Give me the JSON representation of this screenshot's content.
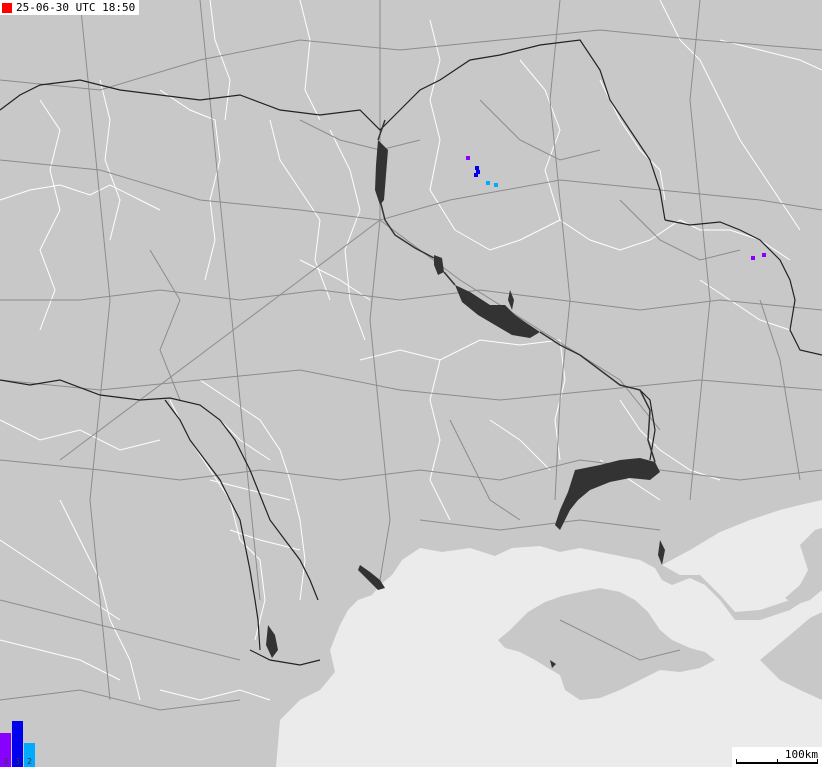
{
  "timestamp": {
    "text": "25-06-30 UTC 18:50",
    "indicator_color": "#ff0000"
  },
  "scale": {
    "label": "100km"
  },
  "legend": {
    "bars": [
      {
        "label": "3",
        "color": "#8800ff"
      },
      {
        "label": "3",
        "color": "#0000ee"
      },
      {
        "label": "2",
        "color": "#00aaff"
      }
    ]
  },
  "strikes": [
    {
      "color": "#8800ff"
    },
    {
      "color": "#0000ee"
    },
    {
      "color": "#00aaff"
    }
  ],
  "colors": {
    "land": "#c8c8c8",
    "sea": "#ebebeb",
    "water": "#333333",
    "borders": "#ffffff",
    "roads": "#8c8c8c",
    "country_borders": "#222222"
  }
}
